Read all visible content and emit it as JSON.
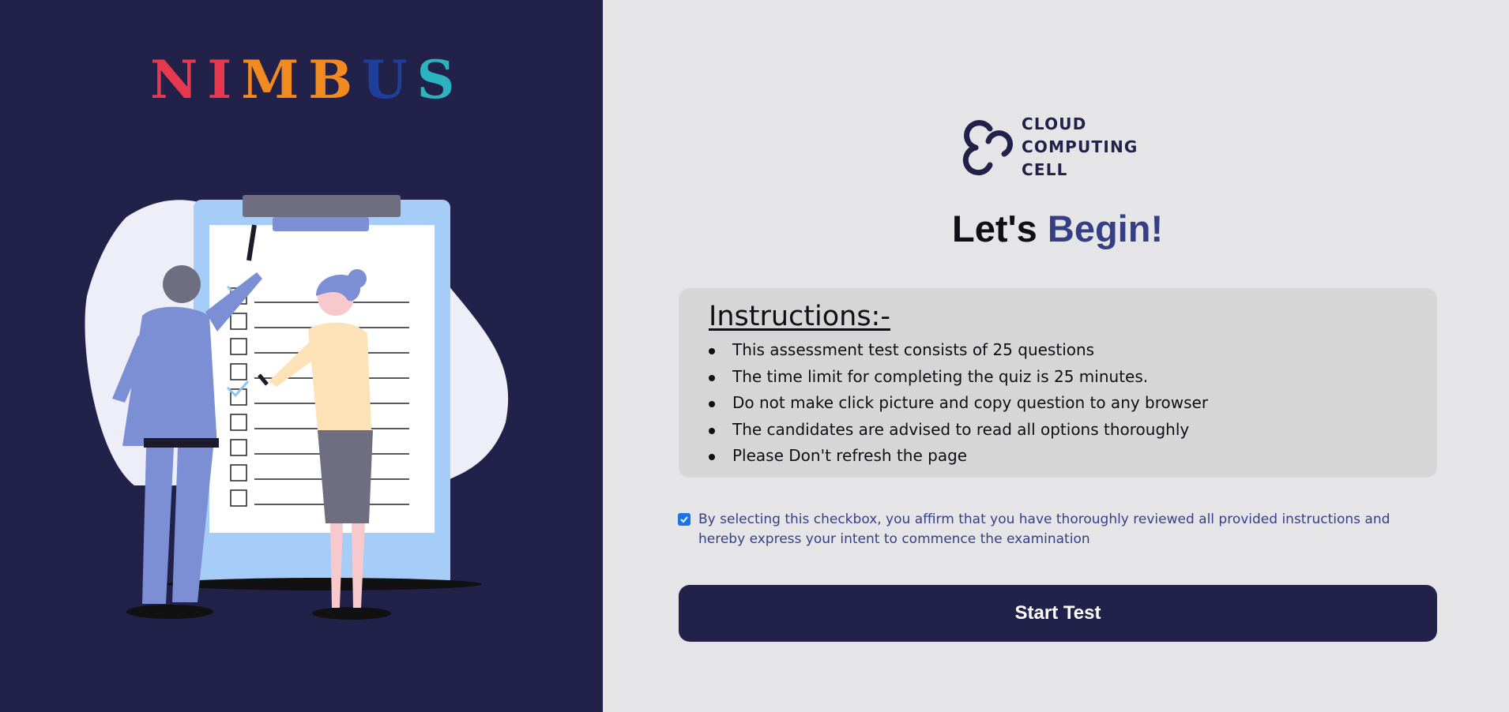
{
  "brand": {
    "letters": [
      "N",
      "I",
      "M",
      "B",
      "U",
      "S"
    ],
    "letter_colors": [
      "#e6394f",
      "#e6394f",
      "#f28a22",
      "#f28a22",
      "#1e3f9a",
      "#2bb3c0"
    ]
  },
  "org": {
    "name_line1": "CLOUD",
    "name_line2": "COMPUTING",
    "name_line3": "CELL"
  },
  "heading": {
    "prefix": "Let's",
    "accent": "Begin!"
  },
  "instructions": {
    "title": "Instructions:-",
    "items": [
      "This assessment test consists of 25 questions",
      "The time limit for completing the quiz is 25 minutes.",
      "Do not make click picture and copy question to any browser",
      "The candidates are advised to read all options thoroughly",
      "Please Don't refresh the page"
    ]
  },
  "consent": {
    "checked": true,
    "text": "By selecting this checkbox, you affirm that you have thoroughly reviewed all provided instructions and hereby express your intent to commence the examination"
  },
  "start_button": {
    "label": "Start Test"
  },
  "colors": {
    "left_bg": "#22214a",
    "right_bg": "#e5e5e8",
    "accent": "#363f86",
    "button_bg": "#22214a",
    "instructions_bg": "#d6d6d6"
  }
}
